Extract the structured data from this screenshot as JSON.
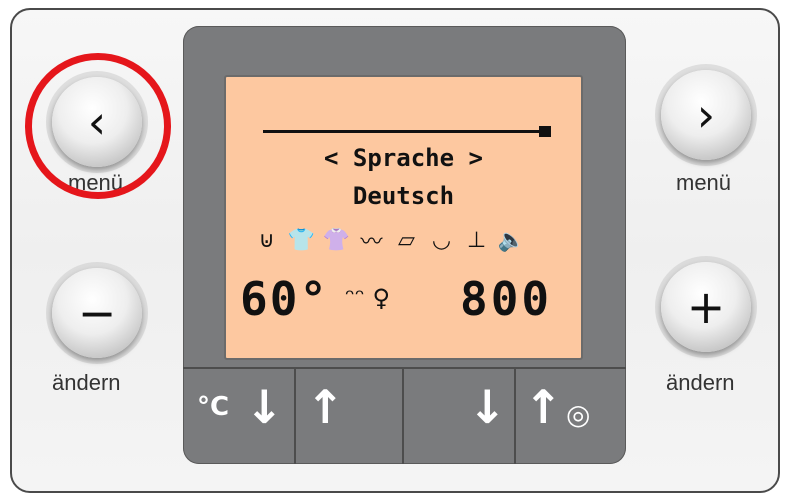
{
  "display": {
    "title": "< Sprache >",
    "value": "Deutsch",
    "temperature": "60°",
    "rpm": "800",
    "extra_icons": "ᵔᵔ ♀",
    "icons": [
      "prewash-icon",
      "shirt-icon",
      "shirt-easy-icon",
      "wash-icon",
      "iron-icon",
      "rinse-icon",
      "drain-icon",
      "speaker-icon"
    ],
    "icon_glyphs": [
      "⊍",
      "👕",
      "👚",
      "〰",
      "▱",
      "◡",
      "⊥",
      "🔈"
    ]
  },
  "buttons": {
    "left_top": {
      "glyph": "‹",
      "label": "menü"
    },
    "right_top": {
      "glyph": "›",
      "label": "menü"
    },
    "left_bottom": {
      "glyph": "−",
      "label": "ändern"
    },
    "right_bottom": {
      "glyph": "+",
      "label": "ändern"
    }
  },
  "bottom_keys": {
    "k1_unit": "°C",
    "k1_arrow": "↓",
    "k2_arrow": "↑",
    "k3_arrow": "↓",
    "k4_arrow": "↑",
    "k4_spin": "◎"
  },
  "highlight": {
    "color": "#e5161b",
    "target": "left_top"
  }
}
